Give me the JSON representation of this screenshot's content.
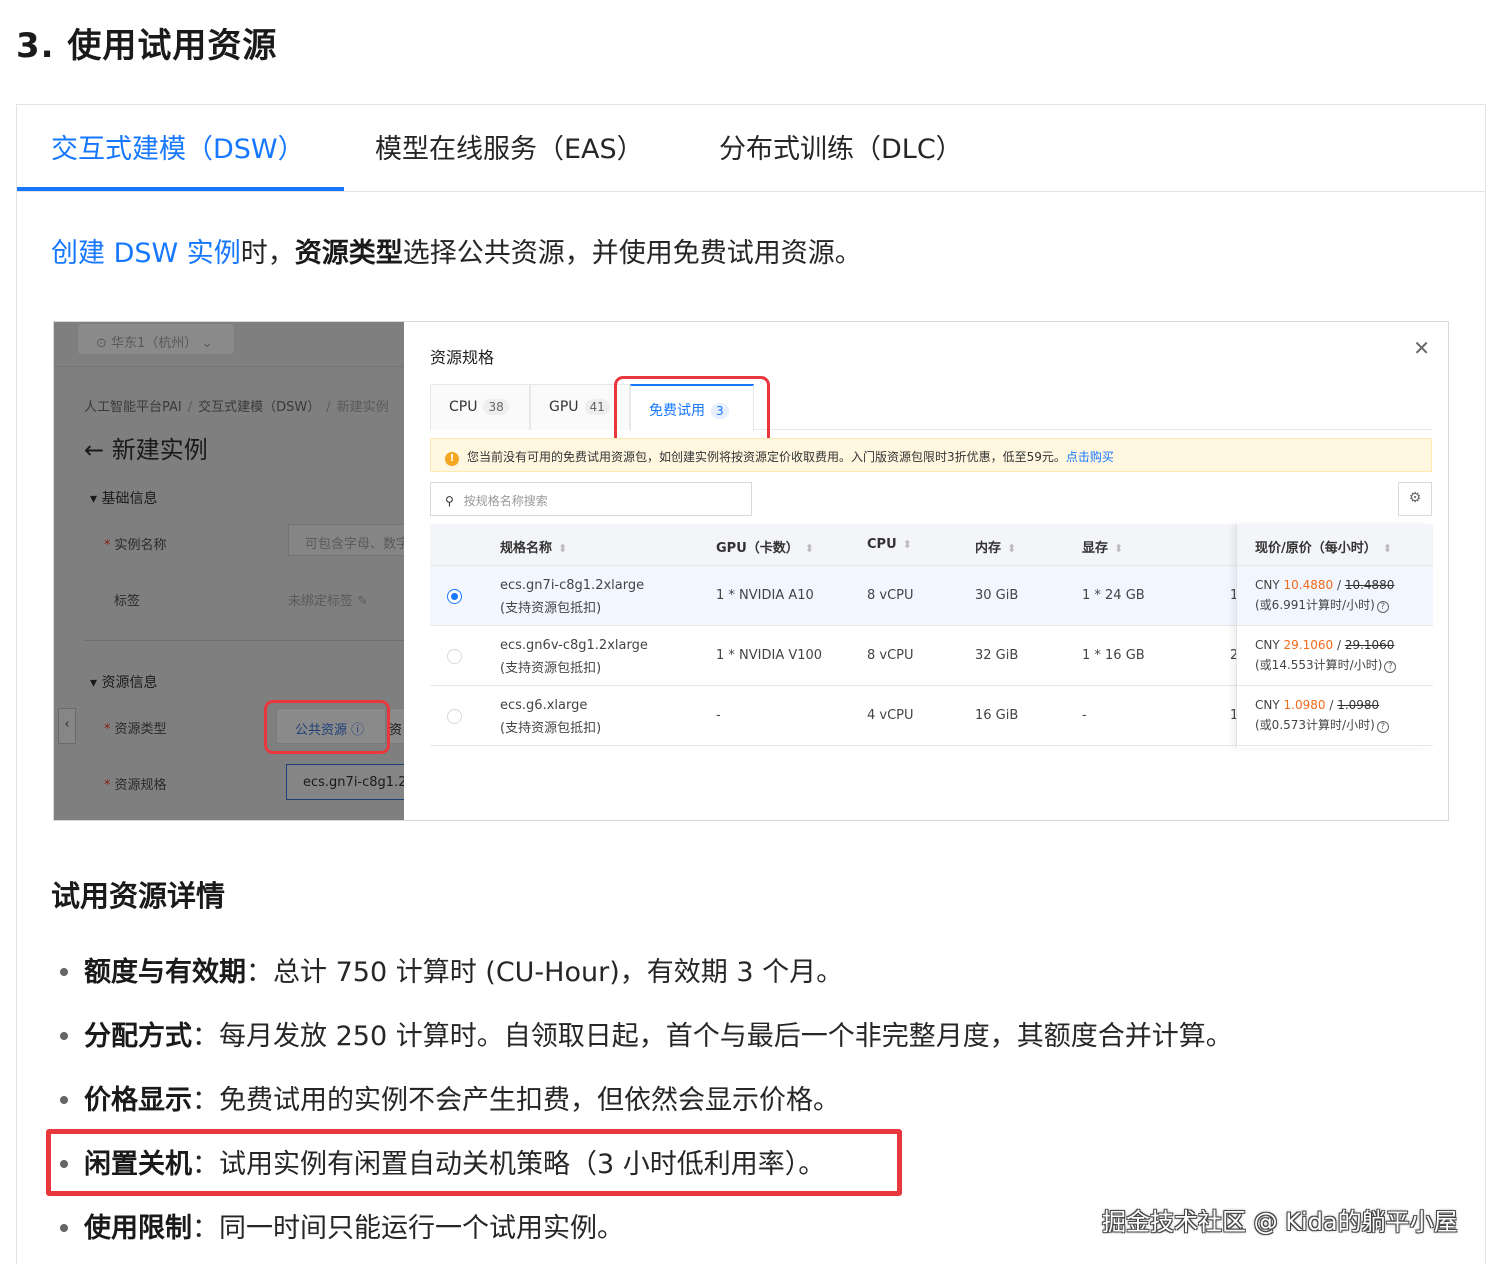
{
  "heading": "3. 使用试用资源",
  "tabs": [
    {
      "label": "交互式建模（DSW）",
      "active": true
    },
    {
      "label": "模型在线服务（EAS）",
      "active": false
    },
    {
      "label": "分布式训练（DLC）",
      "active": false
    }
  ],
  "intro": {
    "link": "创建 DSW 实例",
    "text1": "时，",
    "bold": "资源类型",
    "text2": "选择公共资源，并使用免费试用资源。"
  },
  "screenshot": {
    "left": {
      "region": "华东1（杭州）",
      "breadcrumb": [
        "人工智能平台PAI",
        "交互式建模（DSW）",
        "新建实例"
      ],
      "page_title": "新建实例",
      "section_basic": "基础信息",
      "label_name": "实例名称",
      "name_placeholder": "可包含字母、数字",
      "label_tags": "标签",
      "tags_value": "未绑定标签",
      "section_resource": "资源信息",
      "label_type": "资源类型",
      "type_value": "公共资源",
      "type_value2": "资",
      "label_spec": "资源规格",
      "spec_value": "ecs.gn7i-c8g1.2"
    },
    "dialog": {
      "title": "资源规格",
      "tabs": [
        {
          "label": "CPU",
          "count": "38"
        },
        {
          "label": "GPU",
          "count": "41"
        },
        {
          "label": "免费试用",
          "count": "3"
        }
      ],
      "notice": "您当前没有可用的免费试用资源包，如创建实例将按资源定价收取费用。入门版资源包限时3折优惠，低至59元。",
      "notice_link": "点击购买",
      "search_placeholder": "按规格名称搜索",
      "columns": [
        "规格名称",
        "GPU（卡数）",
        "CPU",
        "内存",
        "显存",
        "现价/原价（每小时）"
      ],
      "rows": [
        {
          "name": "ecs.gn7i-c8g1.2xlarge",
          "note": "(支持资源包抵扣)",
          "gpu": "1 * NVIDIA A10",
          "cpu": "8 vCPU",
          "mem": "30 GiB",
          "vram": "1 * 24 GB",
          "cut": "1",
          "price_now": "10.4880",
          "price_old": "10.4880",
          "cu": "(或6.991计算时/小时)",
          "selected": true
        },
        {
          "name": "ecs.gn6v-c8g1.2xlarge",
          "note": "(支持资源包抵扣)",
          "gpu": "1 * NVIDIA V100",
          "cpu": "8 vCPU",
          "mem": "32 GiB",
          "vram": "1 * 16 GB",
          "cut": "2",
          "price_now": "29.1060",
          "price_old": "29.1060",
          "cu": "(或14.553计算时/小时)",
          "selected": false
        },
        {
          "name": "ecs.g6.xlarge",
          "note": "(支持资源包抵扣)",
          "gpu": "-",
          "cpu": "4 vCPU",
          "mem": "16 GiB",
          "vram": "-",
          "cut": "1",
          "price_now": "1.0980",
          "price_old": "1.0980",
          "cu": "(或0.573计算时/小时)",
          "selected": false
        }
      ],
      "currency": "CNY"
    }
  },
  "details_heading": "试用资源详情",
  "bullets": [
    {
      "bold": "额度与有效期",
      "text": "：总计 750 计算时 (CU-Hour)，有效期 3 个月。"
    },
    {
      "bold": "分配方式",
      "text": "：每月发放 250 计算时。自领取日起，首个与最后一个非完整月度，其额度合并计算。"
    },
    {
      "bold": "价格显示",
      "text": "：免费试用的实例不会产生扣费，但依然会显示价格。"
    },
    {
      "bold": "闲置关机",
      "text": "：试用实例有闲置自动关机策略（3 小时低利用率）。"
    },
    {
      "bold": "使用限制",
      "text": "：同一时间只能运行一个试用实例。"
    }
  ],
  "watermark": "掘金技术社区 @ Kida的躺平小屋",
  "colors": {
    "accent": "#1677ff",
    "highlight": "#e8383d",
    "price": "#f26a1b"
  }
}
